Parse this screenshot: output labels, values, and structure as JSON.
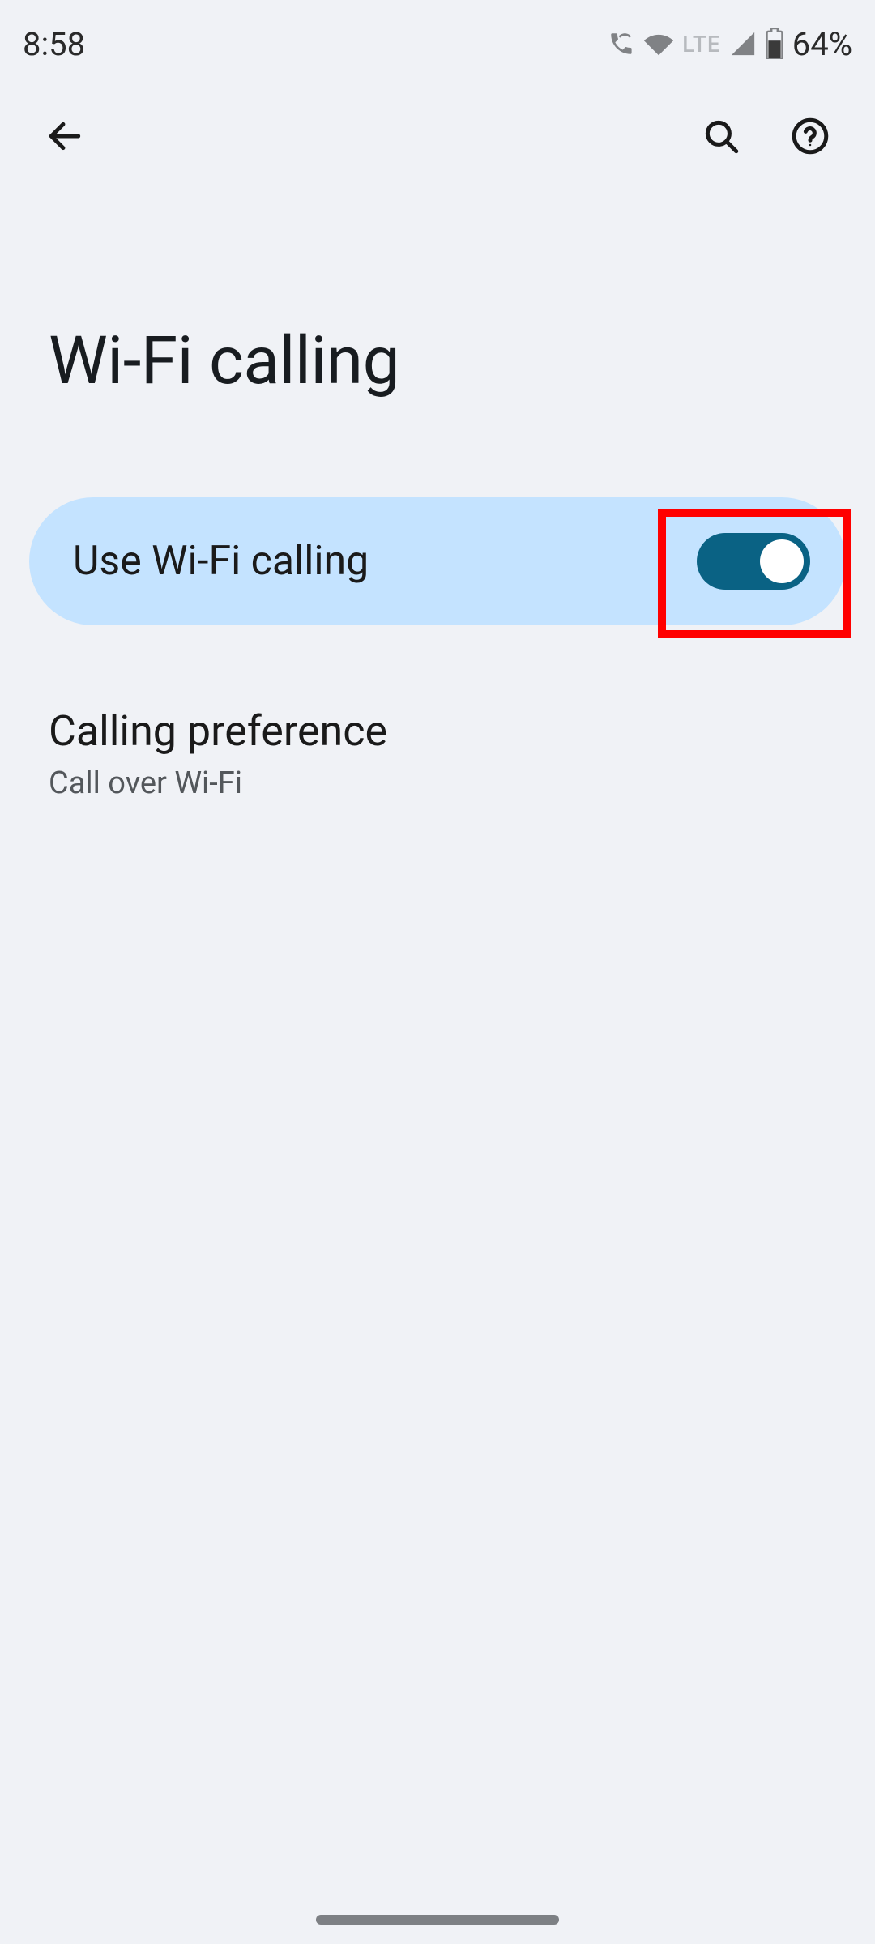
{
  "status_bar": {
    "time": "8:58",
    "network_label": "LTE",
    "battery_pct": "64%"
  },
  "page_title": "Wi-Fi calling",
  "toggle": {
    "label": "Use Wi-Fi calling",
    "on": true
  },
  "preference": {
    "title": "Calling preference",
    "subtitle": "Call over Wi-Fi"
  }
}
